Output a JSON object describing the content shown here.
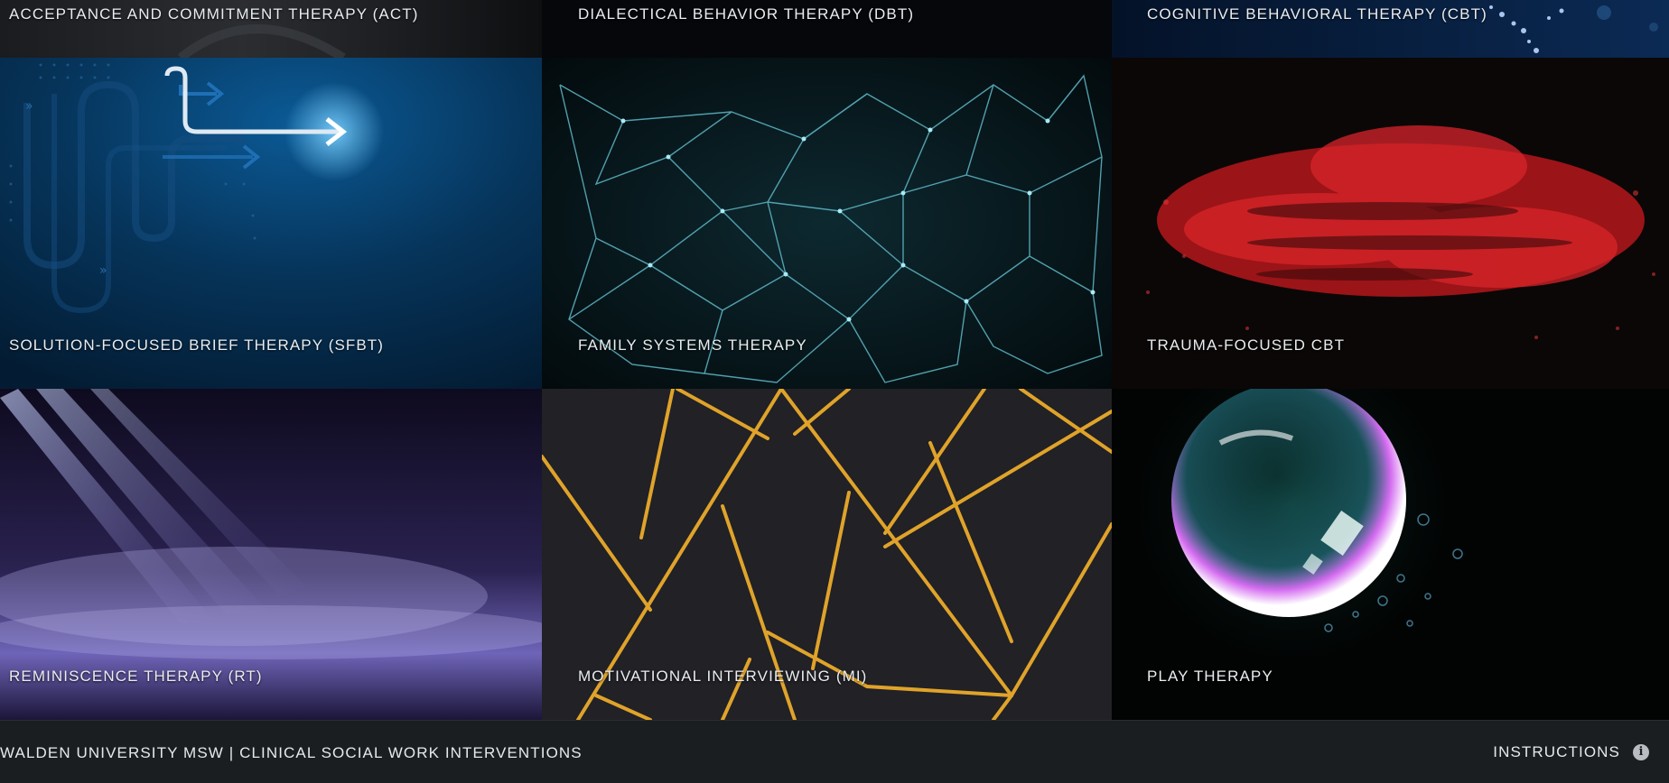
{
  "tiles": [
    {
      "label": "ACCEPTANCE AND COMMITMENT THERAPY (ACT)"
    },
    {
      "label": "DIALECTICAL BEHAVIOR THERAPY (DBT)"
    },
    {
      "label": "COGNITIVE BEHAVIORAL THERAPY (CBT)"
    },
    {
      "label": "SOLUTION-FOCUSED BRIEF THERAPY (SFBT)"
    },
    {
      "label": "FAMILY SYSTEMS THERAPY"
    },
    {
      "label": "TRAUMA-FOCUSED CBT"
    },
    {
      "label": "REMINISCENCE THERAPY (RT)"
    },
    {
      "label": "MOTIVATIONAL INTERVIEWING (MI)"
    },
    {
      "label": "PLAY THERAPY"
    }
  ],
  "footer": {
    "brand": "WALDEN UNIVERSITY MSW | CLINICAL SOCIAL WORK INTERVENTIONS",
    "instructions_label": "INSTRUCTIONS",
    "info_icon": "i"
  },
  "colors": {
    "footer_bg": "#1b1e21",
    "label_text": "#e9edf0",
    "sfbt_blue": "#062f4e",
    "network_cyan": "#5fb8c8",
    "trauma_red": "#c0151a",
    "gold_lines": "#e0a32a",
    "rt_purple": "#7b6fd0"
  }
}
